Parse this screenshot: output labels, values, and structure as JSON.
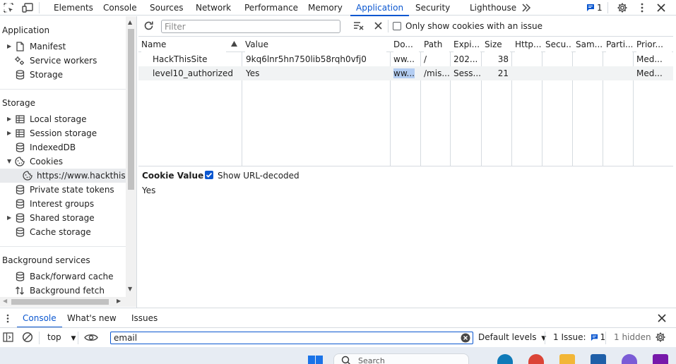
{
  "topbar": {
    "tabs": [
      {
        "label": "Elements"
      },
      {
        "label": "Console"
      },
      {
        "label": "Sources"
      },
      {
        "label": "Network"
      },
      {
        "label": "Performance"
      },
      {
        "label": "Memory"
      },
      {
        "label": "Application",
        "active": true
      },
      {
        "label": "Security"
      },
      {
        "label": "Lighthouse"
      }
    ],
    "issues_count": "1",
    "more_tabs_icon": "double-chevron-right-icon"
  },
  "sidebar": {
    "application_header": "Application",
    "application_items": [
      {
        "label": "Manifest",
        "icon": "file-icon",
        "expandable": true
      },
      {
        "label": "Service workers",
        "icon": "gears-icon"
      },
      {
        "label": "Storage",
        "icon": "database-icon"
      }
    ],
    "storage_header": "Storage",
    "storage_items": [
      {
        "label": "Local storage",
        "icon": "table-icon",
        "expandable": true
      },
      {
        "label": "Session storage",
        "icon": "table-icon",
        "expandable": true
      },
      {
        "label": "IndexedDB",
        "icon": "database-icon"
      },
      {
        "label": "Cookies",
        "icon": "cookie-icon",
        "expanded": true
      },
      {
        "label": "https://www.hackthissit",
        "icon": "cookie-icon",
        "child": true,
        "selected": true
      },
      {
        "label": "Private state tokens",
        "icon": "database-icon"
      },
      {
        "label": "Interest groups",
        "icon": "database-icon"
      },
      {
        "label": "Shared storage",
        "icon": "database-icon",
        "expandable": true
      },
      {
        "label": "Cache storage",
        "icon": "database-icon"
      }
    ],
    "background_header": "Background services",
    "background_items": [
      {
        "label": "Back/forward cache",
        "icon": "database-icon"
      },
      {
        "label": "Background fetch",
        "icon": "updown-arrows-icon"
      }
    ]
  },
  "cookies_toolbar": {
    "filter_placeholder": "Filter",
    "only_issues_label": "Only show cookies with an issue",
    "only_issues_checked": false
  },
  "cookies_table": {
    "columns": [
      "Name",
      "Value",
      "Do...",
      "Path",
      "Expi...",
      "Size",
      "Http...",
      "Secu...",
      "Sam...",
      "Parti...",
      "Prior..."
    ],
    "sorted_column": "Name",
    "rows": [
      {
        "name": "HackThisSite",
        "value": "9kq6lnr5hn750lib58rqh0vfj0",
        "domain": "ww...",
        "path": "/",
        "expires": "202...",
        "size": "38",
        "http": "",
        "secure": "",
        "samesite": "",
        "partition": "",
        "priority": "Med..."
      },
      {
        "name": "level10_authorized",
        "value": "Yes",
        "domain": "ww...",
        "path": "/mis...",
        "expires": "Sess...",
        "size": "21",
        "http": "",
        "secure": "",
        "samesite": "",
        "partition": "",
        "priority": "Med..."
      }
    ]
  },
  "cookie_value_panel": {
    "title": "Cookie Value",
    "show_decoded_label": "Show URL-decoded",
    "show_decoded_checked": true,
    "value": "Yes"
  },
  "drawer": {
    "tabs": [
      {
        "label": "Console",
        "active": true
      },
      {
        "label": "What's new"
      },
      {
        "label": "Issues"
      }
    ],
    "context": "top",
    "filter_value": "email",
    "levels": "Default levels",
    "issues_label": "1 Issue:",
    "issues_count": "1",
    "hidden_label": "1 hidden"
  },
  "taskbar": {
    "search_label": "Search"
  },
  "colors": {
    "accent": "#0b57d0",
    "sidebar_selected": "#e8eaed",
    "row_alt": "#f1f3f4",
    "border": "#d6dbe0"
  }
}
